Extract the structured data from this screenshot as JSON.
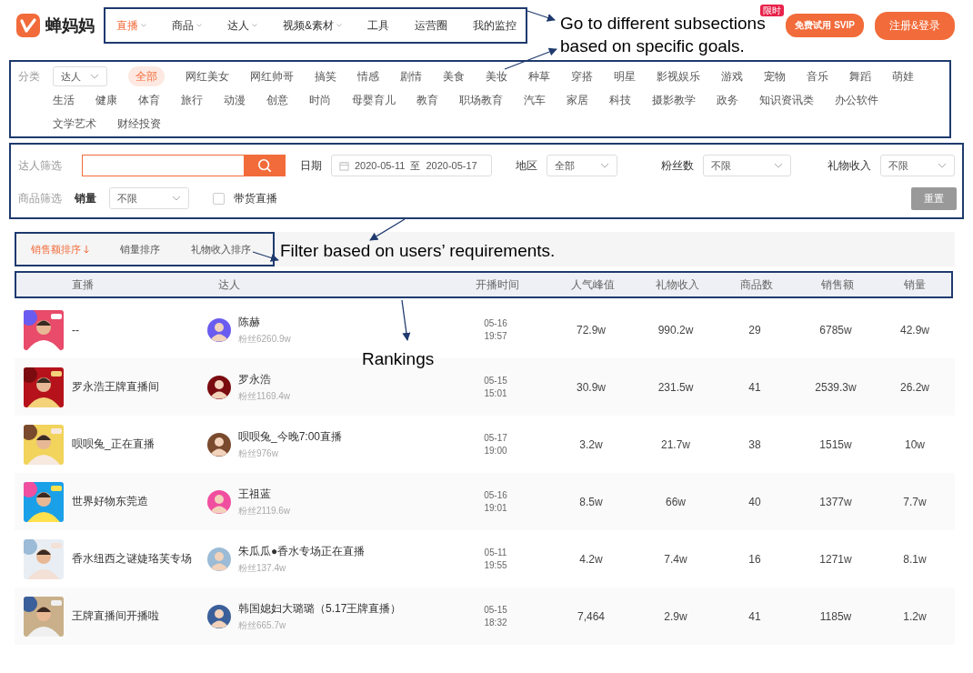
{
  "logo": {
    "name": "蝉妈妈"
  },
  "nav": [
    {
      "label": "直播",
      "selected": true,
      "dropdown": true
    },
    {
      "label": "商品",
      "selected": false,
      "dropdown": true
    },
    {
      "label": "达人",
      "selected": false,
      "dropdown": true
    },
    {
      "label": "视频&素材",
      "selected": false,
      "dropdown": true
    },
    {
      "label": "工具",
      "selected": false,
      "dropdown": false
    },
    {
      "label": "运营圈",
      "selected": false,
      "dropdown": false
    },
    {
      "label": "我的监控",
      "selected": false,
      "dropdown": false
    }
  ],
  "promo": {
    "badge": "限时",
    "label": "免费试用 SVIP"
  },
  "login_button": "注册&登录",
  "categories": {
    "label": "分类",
    "type_select": "达人",
    "items": [
      {
        "label": "全部",
        "selected": true
      },
      {
        "label": "网红美女",
        "selected": false
      },
      {
        "label": "网红帅哥",
        "selected": false
      },
      {
        "label": "搞笑",
        "selected": false
      },
      {
        "label": "情感",
        "selected": false
      },
      {
        "label": "剧情",
        "selected": false
      },
      {
        "label": "美食",
        "selected": false
      },
      {
        "label": "美妆",
        "selected": false
      },
      {
        "label": "种草",
        "selected": false
      },
      {
        "label": "穿搭",
        "selected": false
      },
      {
        "label": "明星",
        "selected": false
      },
      {
        "label": "影视娱乐",
        "selected": false
      },
      {
        "label": "游戏",
        "selected": false
      },
      {
        "label": "宠物",
        "selected": false
      },
      {
        "label": "音乐",
        "selected": false
      },
      {
        "label": "舞蹈",
        "selected": false
      },
      {
        "label": "萌娃",
        "selected": false
      },
      {
        "label": "生活",
        "selected": false
      },
      {
        "label": "健康",
        "selected": false
      },
      {
        "label": "体育",
        "selected": false
      },
      {
        "label": "旅行",
        "selected": false
      },
      {
        "label": "动漫",
        "selected": false
      },
      {
        "label": "创意",
        "selected": false
      },
      {
        "label": "时尚",
        "selected": false
      },
      {
        "label": "母婴育儿",
        "selected": false
      },
      {
        "label": "教育",
        "selected": false
      },
      {
        "label": "职场教育",
        "selected": false
      },
      {
        "label": "汽车",
        "selected": false
      },
      {
        "label": "家居",
        "selected": false
      },
      {
        "label": "科技",
        "selected": false
      },
      {
        "label": "摄影教学",
        "selected": false
      },
      {
        "label": "政务",
        "selected": false
      },
      {
        "label": "知识资讯类",
        "selected": false
      },
      {
        "label": "办公软件",
        "selected": false
      },
      {
        "label": "文学艺术",
        "selected": false
      },
      {
        "label": "财经投资",
        "selected": false
      }
    ]
  },
  "filters": {
    "creator_label": "达人筛选",
    "date_label": "日期",
    "date_start": "2020-05-11",
    "date_separator": "至",
    "date_end": "2020-05-17",
    "region_label": "地区",
    "region_value": "全部",
    "fans_label": "粉丝数",
    "fans_value": "不限",
    "gift_label": "礼物收入",
    "gift_value": "不限",
    "product_label": "商品筛选",
    "volume_label": "销量",
    "volume_value": "不限",
    "live_selling": {
      "label": "带货直播",
      "checked": false
    },
    "reset_button": "重置"
  },
  "sort_tabs": [
    {
      "label": "销售额排序",
      "selected": true
    },
    {
      "label": "销量排序",
      "selected": false
    },
    {
      "label": "礼物收入排序",
      "selected": false
    }
  ],
  "table": {
    "columns": [
      "直播",
      "达人",
      "开播时间",
      "人气峰值",
      "礼物收入",
      "商品数",
      "销售额",
      "销量"
    ],
    "rows": [
      {
        "title": "--",
        "creator": "陈赫",
        "fans": "粉丝6260.9w",
        "date": "05-16",
        "time": "19:57",
        "peak": "72.9w",
        "gift": "990.2w",
        "products": "29",
        "sales": "6785w",
        "volume": "42.9w"
      },
      {
        "title": "罗永浩王牌直播间",
        "creator": "罗永浩",
        "fans": "粉丝1169.4w",
        "date": "05-15",
        "time": "15:01",
        "peak": "30.9w",
        "gift": "231.5w",
        "products": "41",
        "sales": "2539.3w",
        "volume": "26.2w"
      },
      {
        "title": "呗呗兔_正在直播",
        "creator": "呗呗兔_今晚7:00直播",
        "fans": "粉丝976w",
        "date": "05-17",
        "time": "19:00",
        "peak": "3.2w",
        "gift": "21.7w",
        "products": "38",
        "sales": "1515w",
        "volume": "10w"
      },
      {
        "title": "世界好物东莞造",
        "creator": "王祖蓝",
        "fans": "粉丝2119.6w",
        "date": "05-16",
        "time": "19:01",
        "peak": "8.5w",
        "gift": "66w",
        "products": "40",
        "sales": "1377w",
        "volume": "7.7w"
      },
      {
        "title": "香水纽西之谜婕珞芙专场",
        "creator": "朱瓜瓜●香水专场正在直播",
        "fans": "粉丝137.4w",
        "date": "05-11",
        "time": "19:55",
        "peak": "4.2w",
        "gift": "7.4w",
        "products": "16",
        "sales": "1271w",
        "volume": "8.1w"
      },
      {
        "title": "王牌直播间开播啦",
        "creator": "韩国媳妇大璐璐（5.17王牌直播）",
        "fans": "粉丝665.7w",
        "date": "05-15",
        "time": "18:32",
        "peak": "7,464",
        "gift": "2.9w",
        "products": "41",
        "sales": "1185w",
        "volume": "1.2w"
      }
    ]
  },
  "annotations": [
    {
      "kind": "nav",
      "lines": [
        "Go to different subsections",
        "based on specific goals."
      ]
    },
    {
      "kind": "filter",
      "lines": [
        "Filter based on users’ requirements."
      ]
    },
    {
      "kind": "ranking",
      "lines": [
        "Rankings"
      ]
    }
  ]
}
